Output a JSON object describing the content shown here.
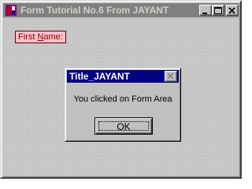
{
  "window": {
    "title": "Form Tutorial No.6 From JAYANT",
    "app_icon": "form-app-icon",
    "controls": [
      "minimize-icon",
      "maximize-icon",
      "close-icon"
    ]
  },
  "form": {
    "label_prefix": "First ",
    "label_hotkey": "N",
    "label_suffix": "ame:"
  },
  "dialog": {
    "title": "Title_JAYANT",
    "message": "You clicked on Form Area",
    "ok_label": "OK",
    "close_icon": "close-icon"
  },
  "colors": {
    "inactive_title_bg": "#808080",
    "dialog_title_bg": "#000080",
    "label_bg": "#ffc0cb",
    "label_fg": "#800000",
    "face": "#c0c0c0"
  }
}
